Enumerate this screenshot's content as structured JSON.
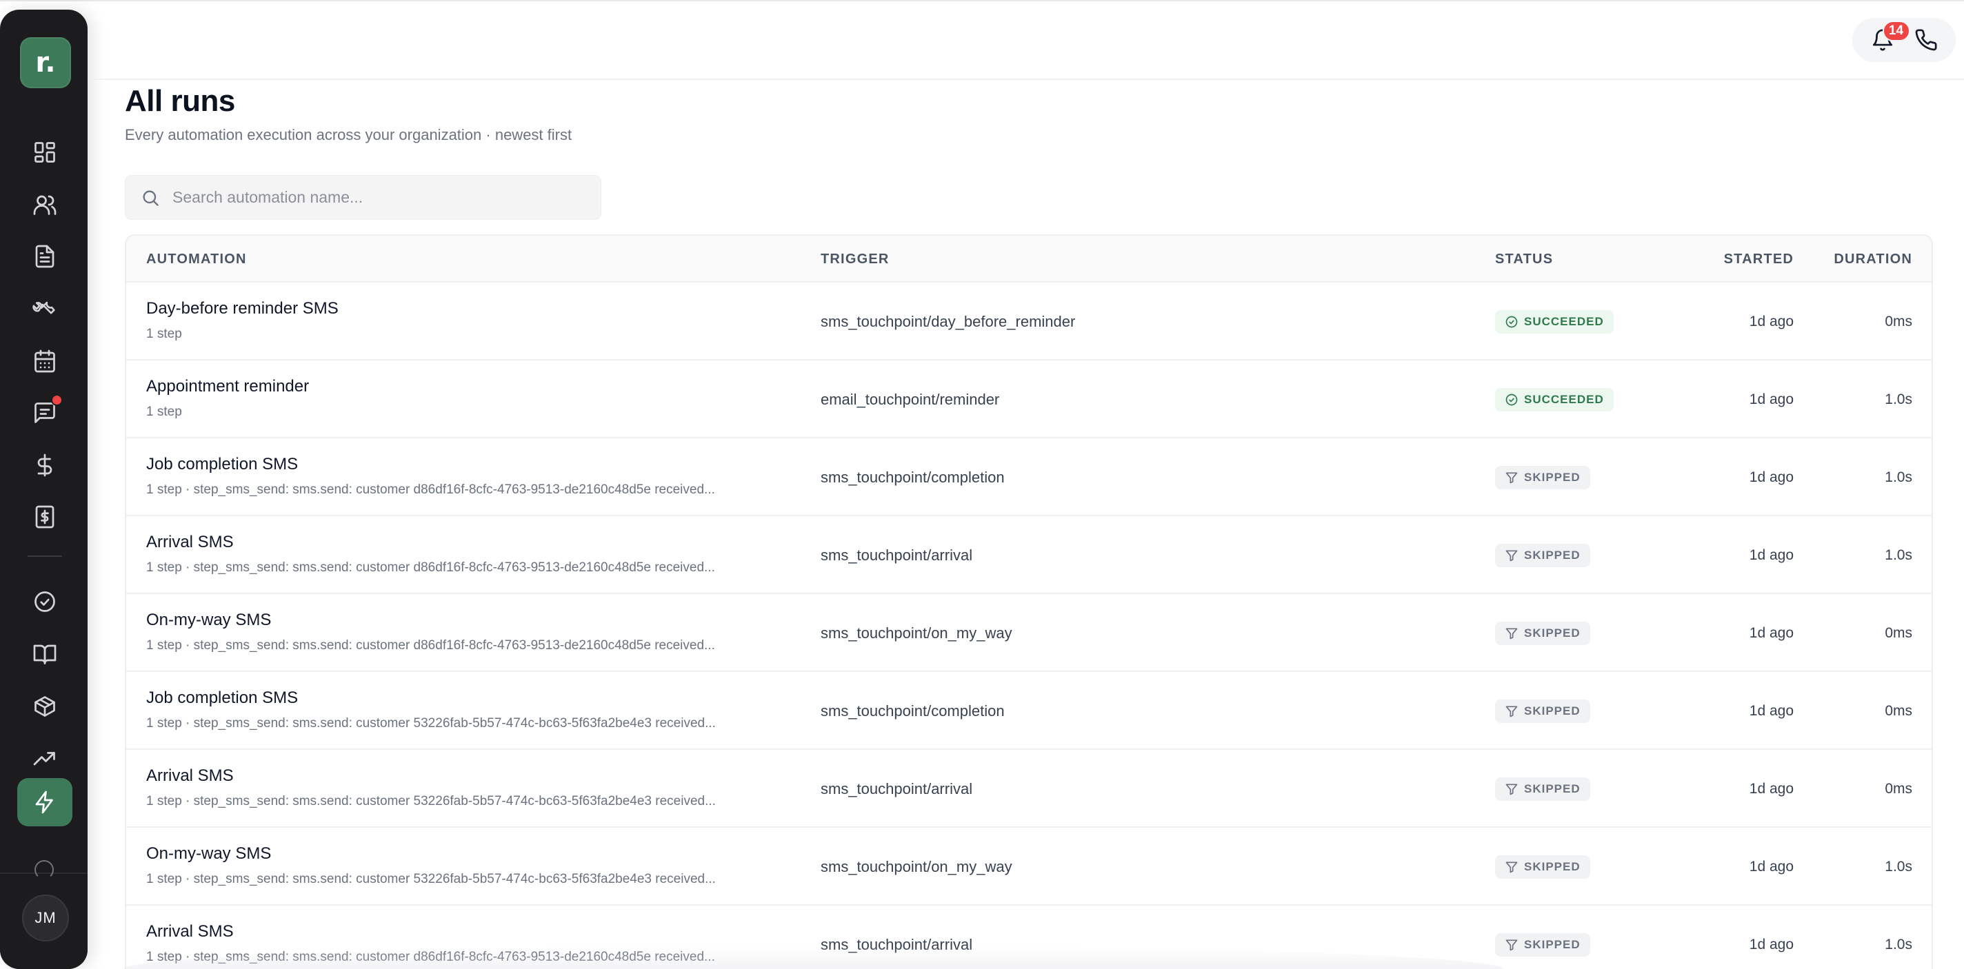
{
  "app": {
    "logo_text": "r."
  },
  "sidebar": {
    "items": [
      {
        "id": "dashboard",
        "icon": "grid-icon"
      },
      {
        "id": "customers",
        "icon": "users-icon"
      },
      {
        "id": "documents",
        "icon": "file-text-icon"
      },
      {
        "id": "jobs",
        "icon": "wrench-icon"
      },
      {
        "id": "calendar",
        "icon": "calendar-icon"
      },
      {
        "id": "messages",
        "icon": "chat-icon",
        "has_notification": true
      },
      {
        "id": "payments",
        "icon": "dollar-icon"
      },
      {
        "id": "invoices",
        "icon": "receipt-dollar-icon"
      },
      {
        "id": "tasks",
        "icon": "check-circle-icon"
      },
      {
        "id": "knowledge",
        "icon": "book-icon"
      },
      {
        "id": "inventory",
        "icon": "box-icon"
      },
      {
        "id": "reports",
        "icon": "trending-up-icon"
      },
      {
        "id": "automations",
        "icon": "lightning-icon",
        "active": true
      }
    ],
    "user_initials": "JM"
  },
  "header": {
    "notifications_count": "14",
    "icons": [
      "bell-icon",
      "phone-icon"
    ]
  },
  "page": {
    "title": "All runs",
    "subtitle": "Every automation execution across your organization · newest first"
  },
  "search": {
    "placeholder": "Search automation name...",
    "value": ""
  },
  "table": {
    "columns": {
      "automation": "AUTOMATION",
      "trigger": "TRIGGER",
      "status": "STATUS",
      "started": "STARTED",
      "duration": "DURATION"
    },
    "rows": [
      {
        "name": "Day-before reminder SMS",
        "detail": "1 step",
        "trigger": "sms_touchpoint/day_before_reminder",
        "status": "SUCCEEDED",
        "status_kind": "succeeded",
        "started": "1d ago",
        "duration": "0ms"
      },
      {
        "name": "Appointment reminder",
        "detail": "1 step",
        "trigger": "email_touchpoint/reminder",
        "status": "SUCCEEDED",
        "status_kind": "succeeded",
        "started": "1d ago",
        "duration": "1.0s"
      },
      {
        "name": "Job completion SMS",
        "detail": "1 step · step_sms_send: sms.send: customer d86df16f-8cfc-4763-9513-de2160c48d5e received...",
        "trigger": "sms_touchpoint/completion",
        "status": "SKIPPED",
        "status_kind": "skipped",
        "started": "1d ago",
        "duration": "1.0s"
      },
      {
        "name": "Arrival SMS",
        "detail": "1 step · step_sms_send: sms.send: customer d86df16f-8cfc-4763-9513-de2160c48d5e received...",
        "trigger": "sms_touchpoint/arrival",
        "status": "SKIPPED",
        "status_kind": "skipped",
        "started": "1d ago",
        "duration": "1.0s"
      },
      {
        "name": "On-my-way SMS",
        "detail": "1 step · step_sms_send: sms.send: customer d86df16f-8cfc-4763-9513-de2160c48d5e received...",
        "trigger": "sms_touchpoint/on_my_way",
        "status": "SKIPPED",
        "status_kind": "skipped",
        "started": "1d ago",
        "duration": "0ms"
      },
      {
        "name": "Job completion SMS",
        "detail": "1 step · step_sms_send: sms.send: customer 53226fab-5b57-474c-bc63-5f63fa2be4e3 received...",
        "trigger": "sms_touchpoint/completion",
        "status": "SKIPPED",
        "status_kind": "skipped",
        "started": "1d ago",
        "duration": "0ms"
      },
      {
        "name": "Arrival SMS",
        "detail": "1 step · step_sms_send: sms.send: customer 53226fab-5b57-474c-bc63-5f63fa2be4e3 received...",
        "trigger": "sms_touchpoint/arrival",
        "status": "SKIPPED",
        "status_kind": "skipped",
        "started": "1d ago",
        "duration": "0ms"
      },
      {
        "name": "On-my-way SMS",
        "detail": "1 step · step_sms_send: sms.send: customer 53226fab-5b57-474c-bc63-5f63fa2be4e3 received...",
        "trigger": "sms_touchpoint/on_my_way",
        "status": "SKIPPED",
        "status_kind": "skipped",
        "started": "1d ago",
        "duration": "1.0s"
      },
      {
        "name": "Arrival SMS",
        "detail": "1 step · step_sms_send: sms.send: customer d86df16f-8cfc-4763-9513-de2160c48d5e received...",
        "trigger": "sms_touchpoint/arrival",
        "status": "SKIPPED",
        "status_kind": "skipped",
        "started": "1d ago",
        "duration": "1.0s"
      }
    ]
  },
  "colors": {
    "brand": "#3d7a5a",
    "sidebar_bg": "#1c1c1e",
    "succeeded": "#2f7a4b",
    "skipped": "#6b7280",
    "badge": "#ef4444"
  }
}
